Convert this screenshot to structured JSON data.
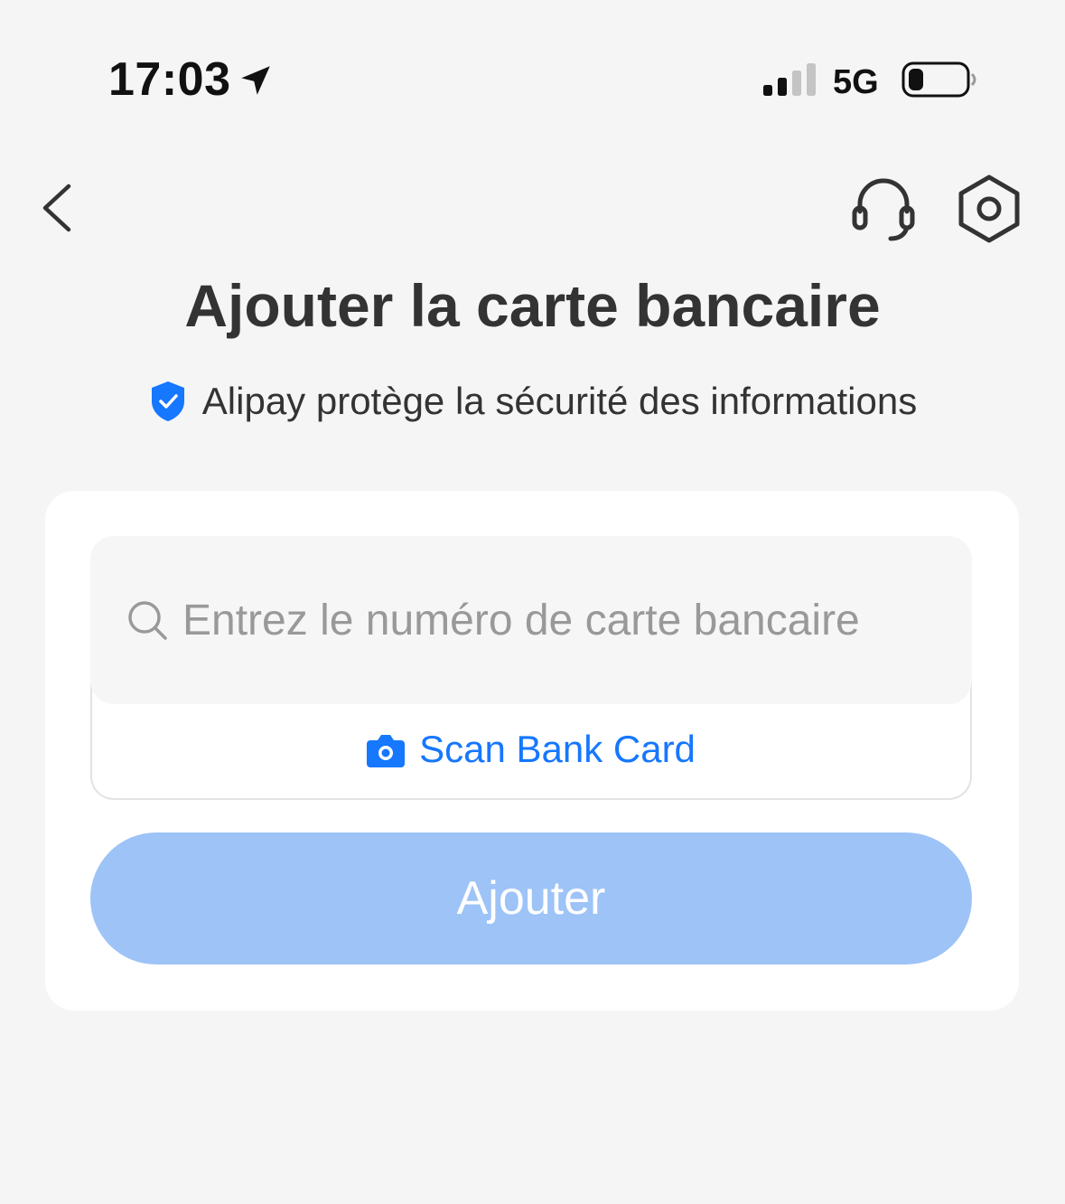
{
  "status_bar": {
    "time": "17:03",
    "network": "5G",
    "icons": [
      "location-arrow-icon",
      "cellular-signal-icon",
      "battery-icon"
    ]
  },
  "nav": {
    "icons": [
      "chevron-left-icon",
      "headset-icon",
      "gear-icon"
    ]
  },
  "page": {
    "title": "Ajouter la carte bancaire",
    "security_text": "Alipay protège la sécurité des informations",
    "security_icon": "shield-check-icon"
  },
  "form": {
    "card_number_value": "",
    "card_number_placeholder": "Entrez le numéro de carte bancaire",
    "search_icon": "search-icon",
    "scan_label": "Scan Bank Card",
    "scan_icon": "camera-icon",
    "submit_label": "Ajouter",
    "submit_disabled": true
  },
  "colors": {
    "background": "#f5f5f5",
    "accent": "#1677ff",
    "button_disabled": "#9dc3f7",
    "title_text": "#333333",
    "placeholder_text": "#999999"
  }
}
